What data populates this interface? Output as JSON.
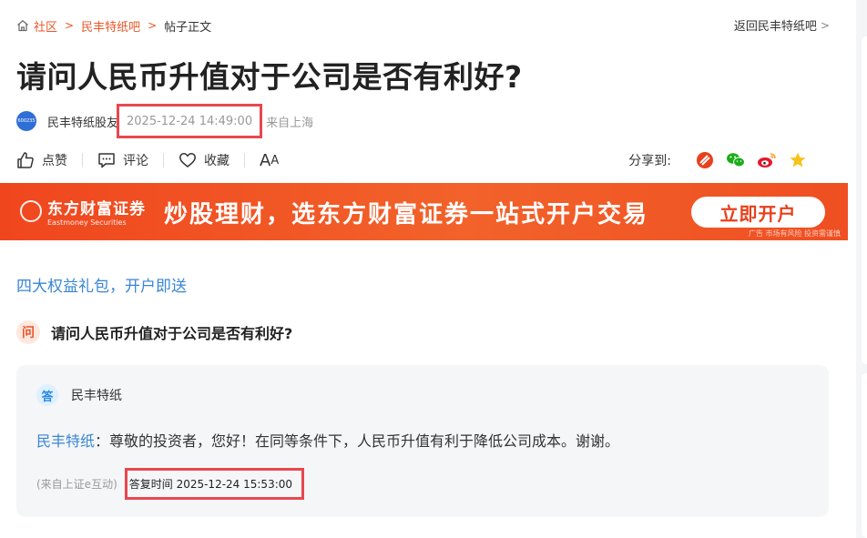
{
  "breadcrumb": {
    "items": [
      "社区",
      "民丰特纸吧"
    ],
    "current": "帖子正文",
    "back_label": "返回民丰特纸吧"
  },
  "post": {
    "title": "请问人民币升值对于公司是否有利好?",
    "avatar_text": "600235",
    "author": "民丰特纸股友",
    "time": "2025-12-24 14:49:00",
    "location": "来自上海"
  },
  "actions": {
    "like": "点赞",
    "comment": "评论",
    "favorite": "收藏",
    "font_large": "A",
    "font_small": "A",
    "share_label": "分享到:"
  },
  "banner": {
    "brand_cn": "东方财富证券",
    "brand_en": "Eastmoney Securities",
    "slogan": "炒股理财，选东方财富证券一站式开户交易",
    "cta": "立即开户",
    "disclaimer": "广告 市场有风险 投资需谨慎"
  },
  "promo": {
    "text": "四大权益礼包，开户即送"
  },
  "qa": {
    "q_badge": "问",
    "question": "请问人民币升值对于公司是否有利好?",
    "a_badge": "答",
    "answerer": "民丰特纸",
    "answer_who": "民丰特纸",
    "answer_text": "：尊敬的投资者，您好！在同等条件下，人民币升值有利于降低公司成本。谢谢。",
    "source": "(来自上证e互动)",
    "reply_time": "答复时间 2025-12-24 15:53:00"
  },
  "colors": {
    "accent": "#e8572a",
    "link": "#3a86d4",
    "highlight_box": "#e8484f",
    "banner": "#f0461e"
  }
}
